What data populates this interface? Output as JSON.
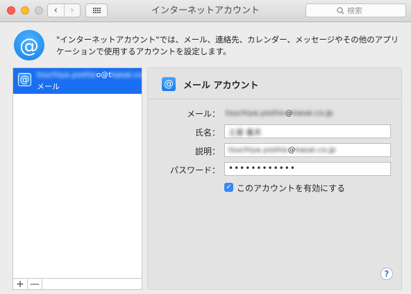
{
  "window": {
    "title": "インターネットアカウント"
  },
  "toolbar": {
    "back": "‹",
    "forward": "›",
    "search_placeholder": "検索"
  },
  "header": {
    "icon_glyph": "@",
    "description": "\"インターネットアカウント\"では、メール、連絡先、カレンダー、メッセージやその他のアプリケーションで使用するアカウントを設定します。"
  },
  "sidebar": {
    "accounts": [
      {
        "email_hidden": "tsuchiya.yoshio",
        "email_at": "o@t",
        "email_tail": "kasai.co.jp",
        "type": "メール"
      }
    ],
    "add_label": "+",
    "remove_label": "—"
  },
  "detail": {
    "title": "メール アカウント",
    "fields": {
      "mail_label": "メール：",
      "mail_value_hidden": "tsuchiya.yoshio",
      "mail_value_at": "@",
      "mail_value_tail": "kasai.co.jp",
      "name_label": "氏名：",
      "name_value": "土屋 義夫",
      "desc_label": "説明：",
      "desc_value_hidden": "tsuchiya.yoshio",
      "desc_value_at": "@",
      "desc_value_tail": "kasai.co.jp",
      "password_label": "パスワード：",
      "password_value": "••••••••••••"
    },
    "enable_label": "このアカウントを有効にする",
    "enable_checked": true,
    "help": "?"
  }
}
